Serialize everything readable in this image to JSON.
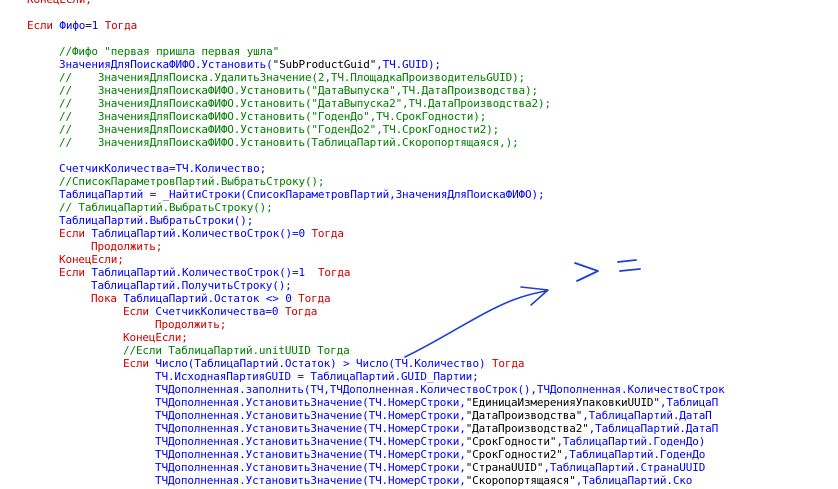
{
  "editor": {
    "language": "1C:Enterprise (BSL)",
    "colors": {
      "keyword": "#d00000",
      "identifier": "#0000ff",
      "string": "#000000",
      "comment": "#008000",
      "annotation_ink": "#1f3fd6"
    },
    "lines": [
      {
        "indent": 0,
        "tokens": [
          [
            "k",
            "КонецЕсли;"
          ]
        ]
      },
      {
        "indent": 0,
        "tokens": []
      },
      {
        "indent": 0,
        "tokens": [
          [
            "k",
            "Если "
          ],
          [
            "i",
            "Фифо"
          ],
          [
            "p",
            "="
          ],
          [
            "i",
            "1"
          ],
          [
            "k",
            " Тогда"
          ]
        ]
      },
      {
        "indent": 0,
        "tokens": []
      },
      {
        "indent": 1,
        "tokens": [
          [
            "c",
            "//Фифо \"первая пришла первая ушла\""
          ]
        ]
      },
      {
        "indent": 1,
        "tokens": [
          [
            "i",
            "ЗначенияДляПоискаФИФО.Установить("
          ],
          [
            "s",
            "\"SubProductGuid\""
          ],
          [
            "i",
            ",ТЧ.GUID);"
          ]
        ]
      },
      {
        "indent": 1,
        "tokens": [
          [
            "c",
            "//    ЗначенияДляПоиска.УдалитьЗначение(2,ТЧ.ПлощадкаПроизводительGUID);"
          ]
        ]
      },
      {
        "indent": 1,
        "tokens": [
          [
            "c",
            "//    ЗначенияДляПоискаФИФО.Установить(\"ДатаВыпуска\",ТЧ.ДатаПроизводства);"
          ]
        ]
      },
      {
        "indent": 1,
        "tokens": [
          [
            "c",
            "//    ЗначенияДляПоискаФИФО.Установить(\"ДатаВыпуска2\",ТЧ.ДатаПроизводства2);"
          ]
        ]
      },
      {
        "indent": 1,
        "tokens": [
          [
            "c",
            "//    ЗначенияДляПоискаФИФО.Установить(\"ГоденДо\",ТЧ.СрокГодности);"
          ]
        ]
      },
      {
        "indent": 1,
        "tokens": [
          [
            "c",
            "//    ЗначенияДляПоискаФИФО.Установить(\"ГоденДо2\",ТЧ.СрокГодности2);"
          ]
        ]
      },
      {
        "indent": 1,
        "tokens": [
          [
            "c",
            "//    ЗначенияДляПоискаФИФО.Установить(ТаблицаПартий.Скоропортящаяся,);"
          ]
        ]
      },
      {
        "indent": 1,
        "tokens": []
      },
      {
        "indent": 1,
        "tokens": [
          [
            "i",
            "СчетчикКоличества=ТЧ.Количество;"
          ]
        ]
      },
      {
        "indent": 1,
        "tokens": [
          [
            "c",
            "//СписокПараметровПартий.ВыбратьСтроку();"
          ]
        ]
      },
      {
        "indent": 1,
        "tokens": [
          [
            "i",
            "ТаблицаПартий = _НайтиСтроки(СписокПараметровПартий,ЗначенияДляПоискаФИФО);"
          ]
        ]
      },
      {
        "indent": 1,
        "tokens": [
          [
            "c",
            "// ТаблицаПартий.ВыбратьСтроку();"
          ]
        ]
      },
      {
        "indent": 1,
        "tokens": [
          [
            "i",
            "ТаблицаПартий.ВыбратьСтроки();"
          ]
        ]
      },
      {
        "indent": 1,
        "tokens": [
          [
            "k",
            "Если "
          ],
          [
            "i",
            "ТаблицаПартий.КоличествоСтрок()=0"
          ],
          [
            "k",
            " Тогда"
          ]
        ]
      },
      {
        "indent": 2,
        "tokens": [
          [
            "k",
            "Продолжить;"
          ]
        ]
      },
      {
        "indent": 1,
        "tokens": [
          [
            "k",
            "КонецЕсли;"
          ]
        ]
      },
      {
        "indent": 1,
        "tokens": [
          [
            "k",
            "Если "
          ],
          [
            "i",
            "ТаблицаПартий.КоличествоСтрок()=1"
          ],
          [
            "k",
            "  Тогда"
          ]
        ]
      },
      {
        "indent": 2,
        "tokens": [
          [
            "i",
            "ТаблицаПартий.ПолучитьСтроку();"
          ]
        ]
      },
      {
        "indent": 2,
        "tokens": [
          [
            "k",
            "Пока "
          ],
          [
            "i",
            "ТаблицаПартий.Остаток <> 0"
          ],
          [
            "k",
            " Тогда"
          ]
        ]
      },
      {
        "indent": 3,
        "tokens": [
          [
            "k",
            "Если "
          ],
          [
            "i",
            "СчетчикКоличества=0"
          ],
          [
            "k",
            " Тогда"
          ]
        ]
      },
      {
        "indent": 4,
        "tokens": [
          [
            "k",
            "Продолжить;"
          ]
        ]
      },
      {
        "indent": 3,
        "tokens": [
          [
            "k",
            "КонецЕсли;"
          ]
        ]
      },
      {
        "indent": 3,
        "tokens": [
          [
            "c",
            "//Если ТаблицаПартий.unitUUID Тогда"
          ]
        ]
      },
      {
        "indent": 3,
        "tokens": [
          [
            "k",
            "Если "
          ],
          [
            "i",
            "Число(ТаблицаПартий.Остаток) > Число(ТЧ.Количество)"
          ],
          [
            "k",
            " Тогда"
          ]
        ]
      },
      {
        "indent": 4,
        "tokens": [
          [
            "i",
            "ТЧ.ИсходнаяПартияGUID = ТаблицаПартий.GUID_Партии;"
          ]
        ]
      },
      {
        "indent": 4,
        "tokens": [
          [
            "i",
            "ТЧДополненная.заполнить(ТЧ,ТЧДополненная.КоличествоСтрок(),ТЧДополненная.КоличествоСтрок"
          ]
        ]
      },
      {
        "indent": 4,
        "tokens": [
          [
            "i",
            "ТЧДополненная.УстановитьЗначение(ТЧ.НомерСтроки,"
          ],
          [
            "s",
            "\"ЕдиницаИзмеренияУпаковкиUUID\""
          ],
          [
            "i",
            ",ТаблицаП"
          ]
        ]
      },
      {
        "indent": 4,
        "tokens": [
          [
            "i",
            "ТЧДополненная.УстановитьЗначение(ТЧ.НомерСтроки,"
          ],
          [
            "s",
            "\"ДатаПроизводства\""
          ],
          [
            "i",
            ",ТаблицаПартий.ДатаП"
          ]
        ]
      },
      {
        "indent": 4,
        "tokens": [
          [
            "i",
            "ТЧДополненная.УстановитьЗначение(ТЧ.НомерСтроки,"
          ],
          [
            "s",
            "\"ДатаПроизводства2\""
          ],
          [
            "i",
            ",ТаблицаПартий.ДатаП"
          ]
        ]
      },
      {
        "indent": 4,
        "tokens": [
          [
            "i",
            "ТЧДополненная.УстановитьЗначение(ТЧ.НомерСтроки,"
          ],
          [
            "s",
            "\"СрокГодности\""
          ],
          [
            "i",
            ",ТаблицаПартий.ГоденДо)"
          ]
        ]
      },
      {
        "indent": 4,
        "tokens": [
          [
            "i",
            "ТЧДополненная.УстановитьЗначение(ТЧ.НомерСтроки,"
          ],
          [
            "s",
            "\"СрокГодности2\""
          ],
          [
            "i",
            ",ТаблицаПартий.ГоденДо"
          ]
        ]
      },
      {
        "indent": 4,
        "tokens": [
          [
            "i",
            "ТЧДополненная.УстановитьЗначение(ТЧ.НомерСтроки,"
          ],
          [
            "s",
            "\"СтранаUUID\""
          ],
          [
            "i",
            ",ТаблицаПартий.СтранаUUID"
          ]
        ]
      },
      {
        "indent": 4,
        "tokens": [
          [
            "i",
            "ТЧДополненная.УстановитьЗначение(ТЧ.НомерСтроки,"
          ],
          [
            "s",
            "\"Скоропортящаяся\""
          ],
          [
            "i",
            ",ТаблицаПартий.Ско"
          ]
        ]
      }
    ]
  },
  "annotation": {
    "handwritten_text": ">="
  }
}
